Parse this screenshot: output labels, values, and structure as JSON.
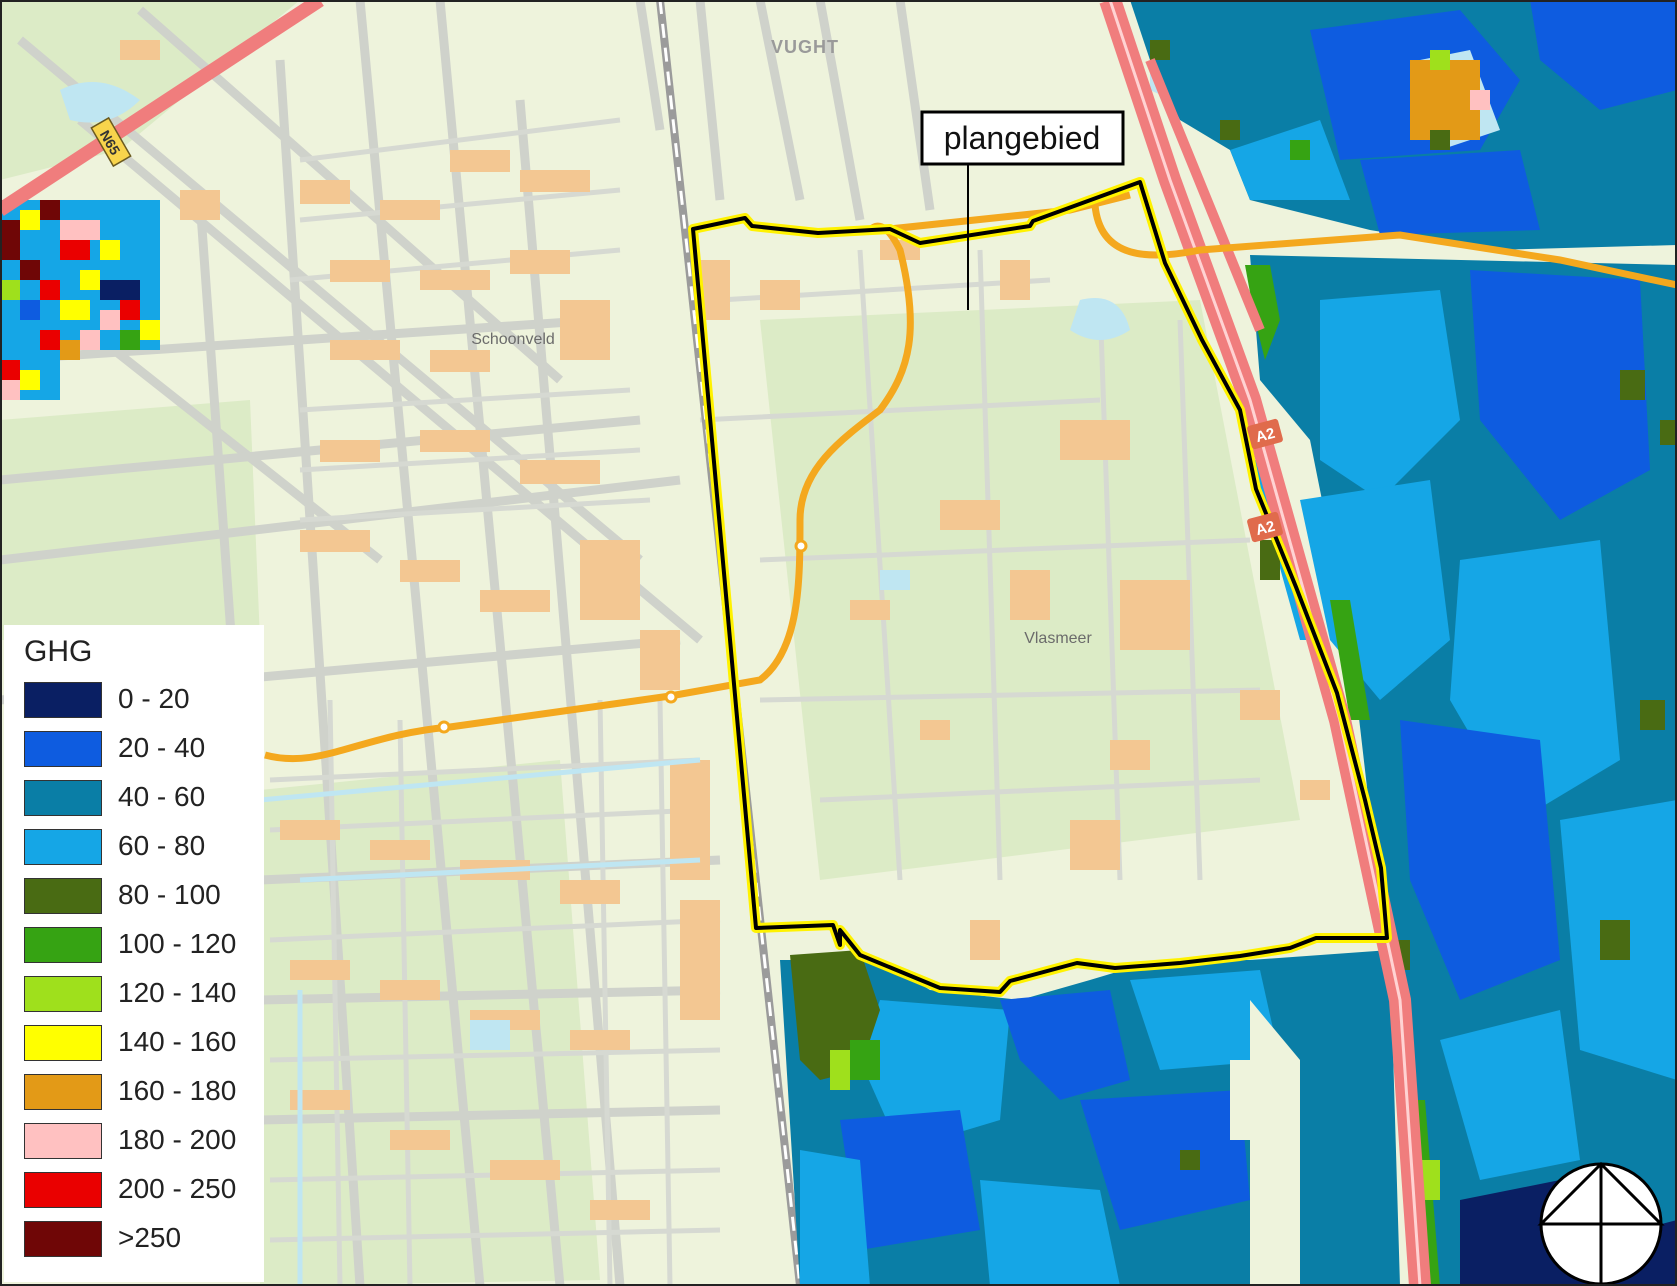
{
  "map": {
    "place_labels": {
      "vught": "VUGHT",
      "schoonveld": "Schoonveld",
      "vlasmeer": "Vlasmeer"
    },
    "road_labels": {
      "n65": "N65",
      "a2_north": "A2",
      "a2_south": "A2"
    },
    "callout": "plangebied",
    "colors": {
      "land": "#eef3dc",
      "green": "#dbe9c4",
      "road": "#c8ccc4",
      "building": "#f3c792",
      "motorway": "#f07d7d",
      "mainroad": "#f4a81e",
      "water": "#bfe6f2",
      "boundary_outline": "#000000",
      "boundary_halo": "#fff200"
    }
  },
  "legend": {
    "title": "GHG",
    "classes": [
      {
        "label": "0 - 20",
        "color": "#0a1f63"
      },
      {
        "label": "20 - 40",
        "color": "#0e5ce0"
      },
      {
        "label": "40 - 60",
        "color": "#0a7ea6"
      },
      {
        "label": "60 - 80",
        "color": "#15a6e6"
      },
      {
        "label": "80 - 100",
        "color": "#496b13"
      },
      {
        "label": "100 - 120",
        "color": "#36a313"
      },
      {
        "label": "120 - 140",
        "color": "#9fe01c"
      },
      {
        "label": "140 - 160",
        "color": "#ffff00"
      },
      {
        "label": "160 - 180",
        "color": "#e39a17"
      },
      {
        "label": "180 - 200",
        "color": "#ffc1c1"
      },
      {
        "label": "200 - 250",
        "color": "#ea0000"
      },
      {
        "label": ">250",
        "color": "#6f0606"
      }
    ]
  },
  "north_arrow": {
    "icon": "north-arrow-icon"
  }
}
